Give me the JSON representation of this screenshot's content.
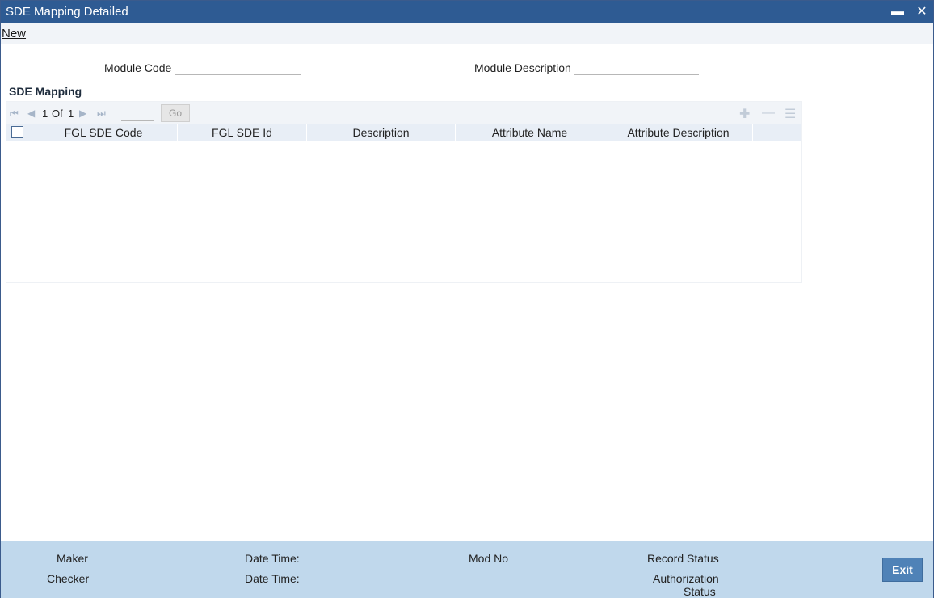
{
  "window": {
    "title": "SDE Mapping Detailed",
    "minimize_icon": "minimize-icon",
    "close_icon": "close-icon"
  },
  "menu": {
    "new_label": "New"
  },
  "form": {
    "module_code_label": "Module Code",
    "module_code_value": "",
    "module_description_label": "Module Description",
    "module_description_value": ""
  },
  "sde_mapping": {
    "title": "SDE Mapping",
    "pager": {
      "current": "1",
      "of_label": "Of",
      "total": "1",
      "page_input": "",
      "go_label": "Go"
    },
    "columns": [
      "FGL SDE Code",
      "FGL SDE Id",
      "Description",
      "Attribute Name",
      "Attribute Description"
    ],
    "rows": []
  },
  "footer": {
    "maker_label": "Maker",
    "checker_label": "Checker",
    "date_time_label_1": "Date Time:",
    "date_time_label_2": "Date Time:",
    "mod_no_label": "Mod No",
    "record_status_label": "Record Status",
    "authorization_label": "Authorization",
    "status_label": "Status",
    "exit_label": "Exit"
  },
  "colors": {
    "titlebar": "#2e5b93",
    "footer": "#c0d8ec",
    "exit_button": "#4f82b7"
  }
}
